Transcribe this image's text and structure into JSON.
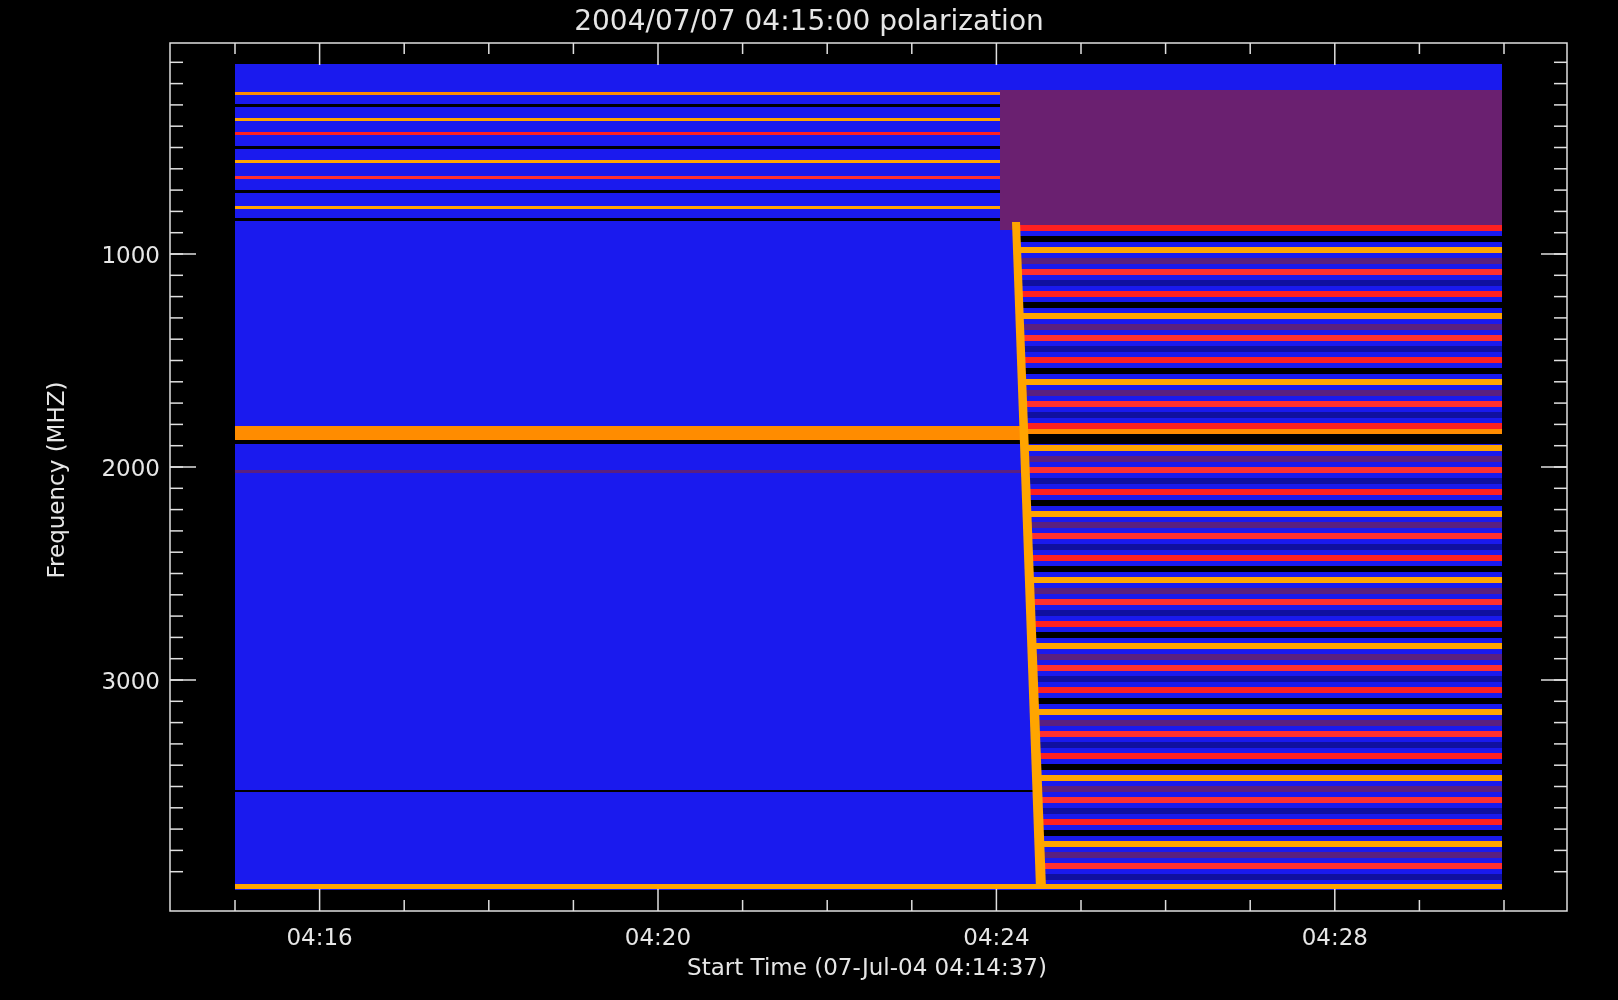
{
  "plot": {
    "title": "2004/07/07 04:15:00 polarization",
    "ylabel": "Frequency (MHZ)",
    "xlabel": "Start Time (07-Jul-04 04:14:37)",
    "xticks": [
      "04:16",
      "04:20",
      "04:24",
      "04:28"
    ],
    "yticks": [
      "1000",
      "2000",
      "3000"
    ]
  }
}
